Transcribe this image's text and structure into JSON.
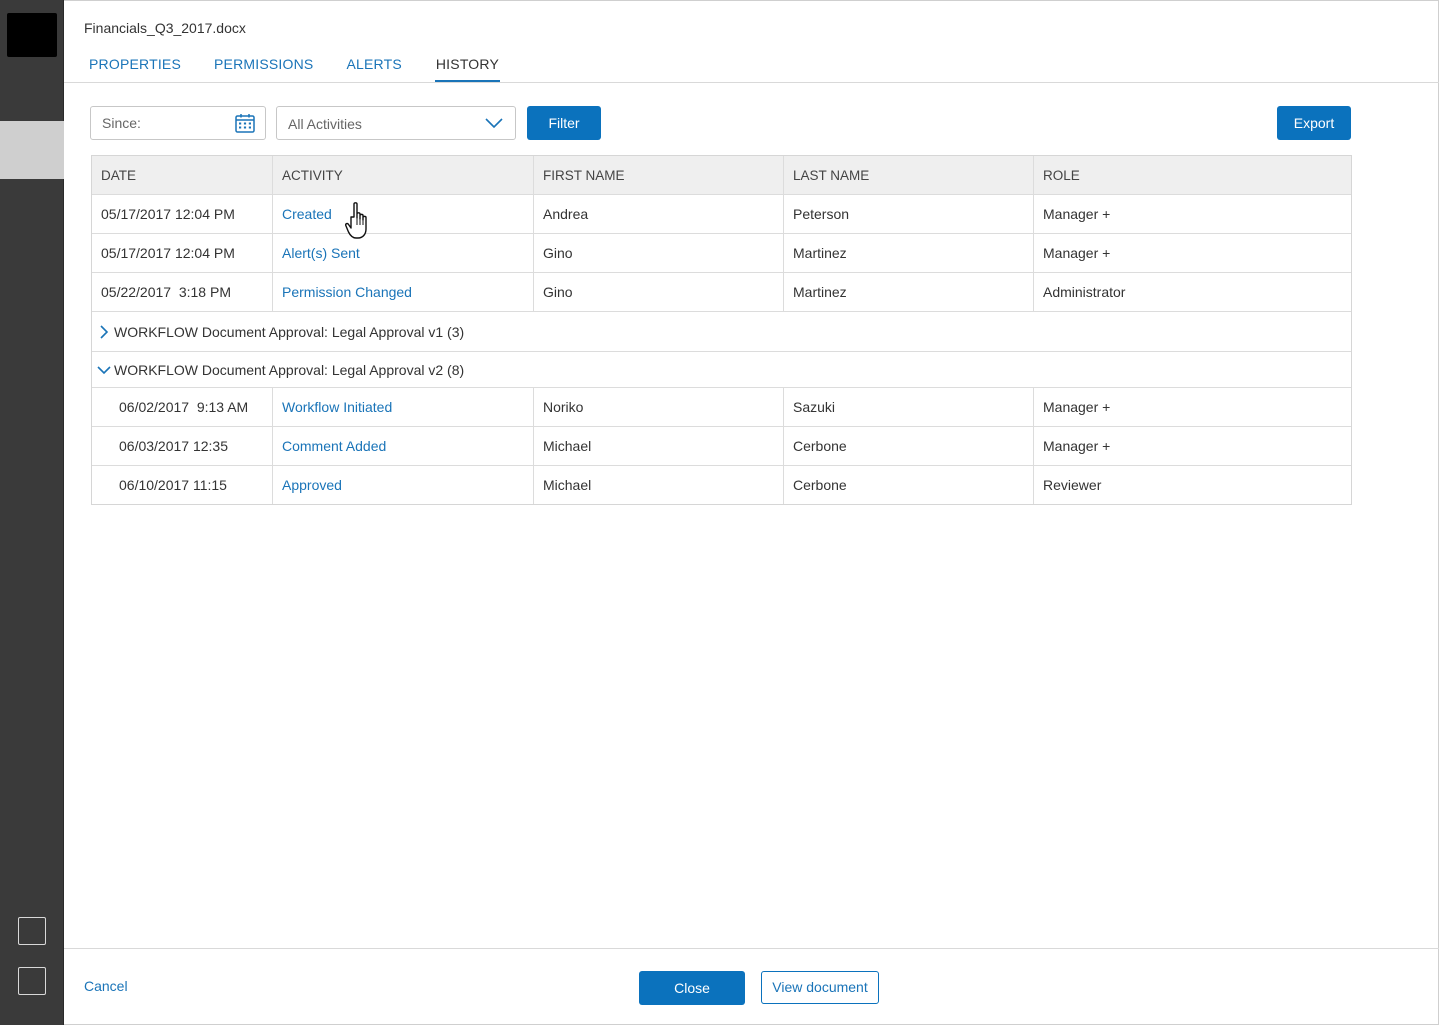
{
  "document": {
    "title": "Financials_Q3_2017.docx"
  },
  "tabs": [
    {
      "label": "PROPERTIES"
    },
    {
      "label": "PERMISSIONS"
    },
    {
      "label": "ALERTS"
    },
    {
      "label": "HISTORY",
      "active": true
    }
  ],
  "toolbar": {
    "since_placeholder": "Since:",
    "activity_select": "All Activities",
    "filter_label": "Filter",
    "export_label": "Export"
  },
  "table": {
    "headers": [
      "DATE",
      "ACTIVITY",
      "FIRST NAME",
      "LAST NAME",
      "ROLE"
    ],
    "rows": [
      {
        "date": "05/17/2017 12:04 PM",
        "activity": "Created",
        "first": "Andrea",
        "last": "Peterson",
        "role": "Manager +"
      },
      {
        "date": "05/17/2017 12:04 PM",
        "activity": "Alert(s) Sent",
        "first": "Gino",
        "last": "Martinez",
        "role": "Manager +"
      },
      {
        "date": "05/22/2017  3:18 PM",
        "activity": "Permission Changed",
        "first": "Gino",
        "last": "Martinez",
        "role": "Administrator"
      }
    ],
    "groups": [
      {
        "label": "WORKFLOW Document Approval: Legal Approval v1 (3)",
        "expanded": false
      },
      {
        "label": "WORKFLOW Document Approval: Legal Approval v2 (8)",
        "expanded": true
      }
    ],
    "group_rows": [
      {
        "date": "06/02/2017  9:13 AM",
        "activity": "Workflow Initiated",
        "first": "Noriko",
        "last": "Sazuki",
        "role": "Manager +"
      },
      {
        "date": "06/03/2017 12:35",
        "activity": "Comment Added",
        "first": "Michael",
        "last": "Cerbone",
        "role": "Manager +"
      },
      {
        "date": "06/10/2017 11:15",
        "activity": "Approved",
        "first": "Michael",
        "last": "Cerbone",
        "role": "Reviewer"
      }
    ]
  },
  "footer": {
    "cancel_label": "Cancel",
    "close_label": "Close",
    "view_label": "View document"
  },
  "icons": [
    "calendar-icon",
    "chevron-down-icon",
    "chevron-right-icon",
    "hand-cursor-icon"
  ],
  "colors": {
    "accent": "#0b72bd",
    "rail": "#3a3a3a"
  }
}
